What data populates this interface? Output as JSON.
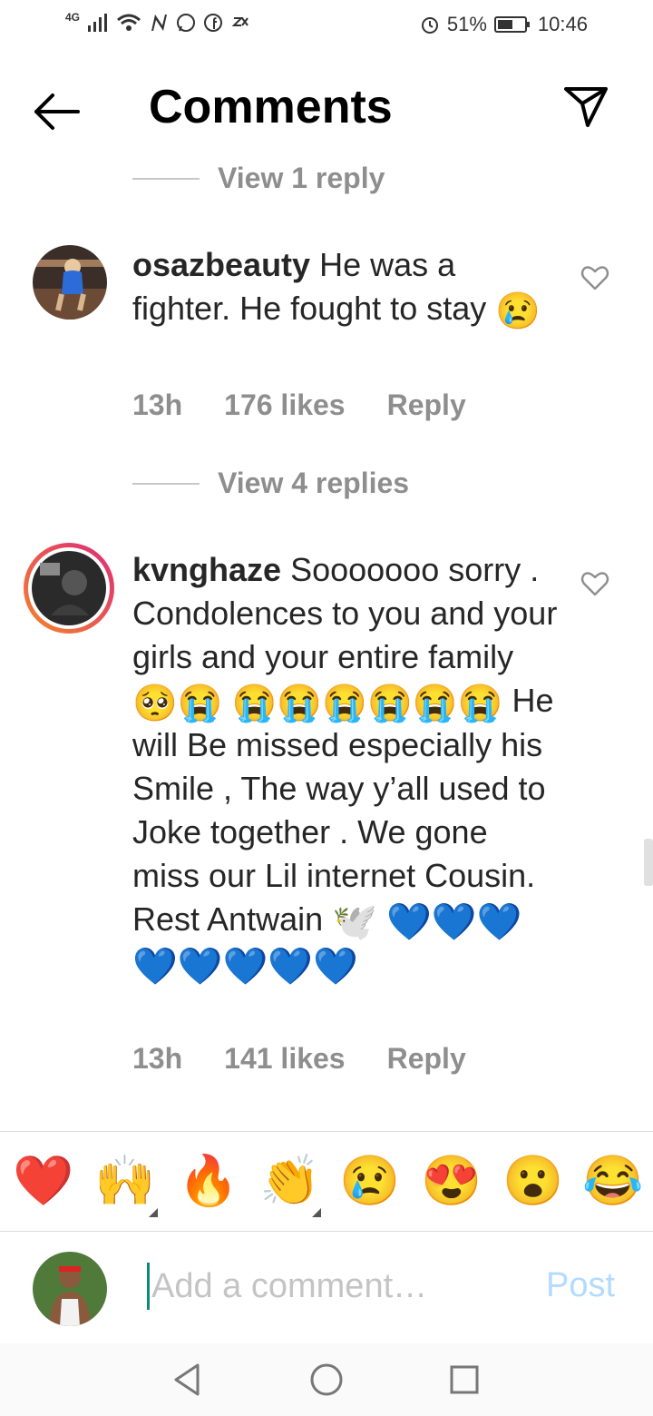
{
  "status_bar": {
    "network": "4G",
    "battery": "51%",
    "time": "10:46",
    "icons": [
      "signal-icon",
      "wifi-icon",
      "n-app-icon",
      "whatsapp-icon",
      "facebook-icon",
      "zx-icon",
      "alarm-icon",
      "battery-icon"
    ]
  },
  "header": {
    "title": "Comments"
  },
  "thread1": {
    "view_replies": "View 1 reply"
  },
  "comment1": {
    "username": "osazbeauty",
    "text": " He was a fighter. He fought to stay ",
    "emoji": "😢",
    "time": "13h",
    "likes": "176 likes",
    "reply": "Reply"
  },
  "thread2": {
    "view_replies": "View 4 replies"
  },
  "comment2": {
    "username": "kvnghaze",
    "text_a": " Sooooooo sorry . Condolences to you and your girls and your entire family ",
    "emojis_a": "🥺😭",
    "emojis_b": "😭😭😭😭😭😭",
    "text_b": " He will Be missed especially his Smile , The way y’all used to Joke together . We gone miss our Lil internet Cousin. Rest Antwain ",
    "emoji_dove": "🕊️",
    "emojis_c": "💙💙💙💙💙💙💙💙",
    "time": "13h",
    "likes": "141 likes",
    "reply": "Reply"
  },
  "emoji_bar": [
    "❤️",
    "🙌",
    "🔥",
    "👏",
    "😢",
    "😍",
    "😮",
    "😂"
  ],
  "compose": {
    "placeholder": "Add a comment…",
    "post": "Post"
  },
  "colors": {
    "muted": "#8e8e8e",
    "post_disabled": "#b3dbff",
    "story_ring_start": "#f58529",
    "story_ring_end": "#dd2a7b"
  }
}
